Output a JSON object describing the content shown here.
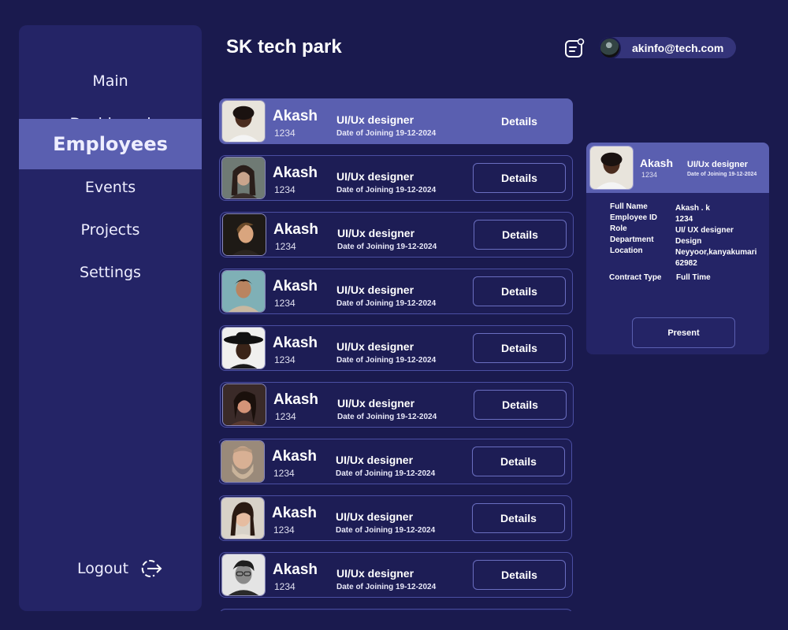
{
  "sidebar": {
    "items": [
      {
        "label": "Main"
      },
      {
        "label": "Dashboard"
      },
      {
        "label": "Employees",
        "active": true
      },
      {
        "label": "Events"
      },
      {
        "label": "Projects"
      },
      {
        "label": "Settings"
      }
    ],
    "logout_label": "Logout"
  },
  "header": {
    "title": "SK tech park",
    "user_email": "akinfo@tech.com"
  },
  "employees": [
    {
      "name": "Akash",
      "id": "1234",
      "role": "UI/Ux designer",
      "doj": "Date of Joining 19-12-2024",
      "action": "Details"
    },
    {
      "name": "Akash",
      "id": "1234",
      "role": "UI/Ux designer",
      "doj": "Date of Joining 19-12-2024",
      "action": "Details"
    },
    {
      "name": "Akash",
      "id": "1234",
      "role": "UI/Ux designer",
      "doj": "Date of Joining 19-12-2024",
      "action": "Details"
    },
    {
      "name": "Akash",
      "id": "1234",
      "role": "UI/Ux designer",
      "doj": "Date of Joining 19-12-2024",
      "action": "Details"
    },
    {
      "name": "Akash",
      "id": "1234",
      "role": "UI/Ux designer",
      "doj": "Date of Joining 19-12-2024",
      "action": "Details"
    },
    {
      "name": "Akash",
      "id": "1234",
      "role": "UI/Ux designer",
      "doj": "Date of Joining 19-12-2024",
      "action": "Details"
    },
    {
      "name": "Akash",
      "id": "1234",
      "role": "UI/Ux designer",
      "doj": "Date of Joining 19-12-2024",
      "action": "Details"
    },
    {
      "name": "Akash",
      "id": "1234",
      "role": "UI/Ux designer",
      "doj": "Date of Joining 19-12-2024",
      "action": "Details"
    },
    {
      "name": "Akash",
      "id": "1234",
      "role": "UI/Ux designer",
      "doj": "Date of Joining 19-12-2024",
      "action": "Details"
    }
  ],
  "detail": {
    "name": "Akash",
    "id": "1234",
    "role": "UI/Ux designer",
    "doj": "Date of Joining 19-12-2024",
    "full_name_label": "Full Name",
    "full_name": "Akash . k",
    "employee_id_label": "Employee ID",
    "employee_id": "1234",
    "role_label": "Role",
    "role_value": "UI/ UX designer",
    "department_label": "Department",
    "department": "Design",
    "location_label": "Location",
    "location_line1": "Neyyoor,kanyakumari",
    "location_line2": "62982",
    "contract_label": "Contract Type",
    "contract": "Full Time",
    "status_button": "Present"
  },
  "colors": {
    "background": "#1a1a4e",
    "panel": "#242466",
    "accent": "#5a5fb0",
    "border": "#4b4fa3"
  }
}
